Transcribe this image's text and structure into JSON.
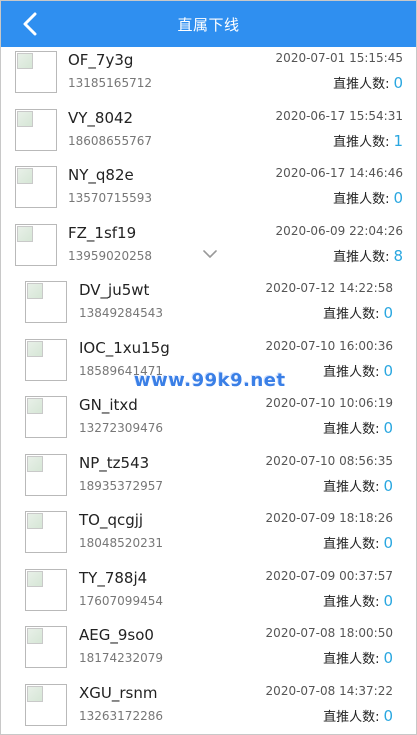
{
  "header": {
    "title": "直属下线",
    "back_icon": "chevron-left-icon",
    "background": "#2f8ff0"
  },
  "count_label": "直推人数:",
  "accent_color": "#2aa7e0",
  "level1": [
    {
      "name": "OF_7y3g",
      "phone": "13185165712",
      "time": "2020-07-01 15:15:45",
      "count": "0"
    },
    {
      "name": "VY_8042",
      "phone": "18608655767",
      "time": "2020-06-17 15:54:31",
      "count": "1"
    },
    {
      "name": "NY_q82e",
      "phone": "13570715593",
      "time": "2020-06-17 14:46:46",
      "count": "0"
    },
    {
      "name": "FZ_1sf19",
      "phone": "13959020258",
      "time": "2020-06-09 22:04:26",
      "count": "8"
    }
  ],
  "level2": [
    {
      "name": "DV_ju5wt",
      "phone": "13849284543",
      "time": "2020-07-12 14:22:58",
      "count": "0"
    },
    {
      "name": "IOC_1xu15g",
      "phone": "18589641471",
      "time": "2020-07-10 16:00:36",
      "count": "0"
    },
    {
      "name": "GN_itxd",
      "phone": "13272309476",
      "time": "2020-07-10 10:06:19",
      "count": "0"
    },
    {
      "name": "NP_tz543",
      "phone": "18935372957",
      "time": "2020-07-10 08:56:35",
      "count": "0"
    },
    {
      "name": "TO_qcgjj",
      "phone": "18048520231",
      "time": "2020-07-09 18:18:26",
      "count": "0"
    },
    {
      "name": "TY_788j4",
      "phone": "17607099454",
      "time": "2020-07-09 00:37:57",
      "count": "0"
    },
    {
      "name": "AEG_9so0",
      "phone": "18174232079",
      "time": "2020-07-08 18:00:50",
      "count": "0"
    },
    {
      "name": "XGU_rsnm",
      "phone": "13263172286",
      "time": "2020-07-08 14:37:22",
      "count": "0"
    }
  ],
  "expander_icon": "chevron-down-icon",
  "watermark": "www.99k9.net"
}
